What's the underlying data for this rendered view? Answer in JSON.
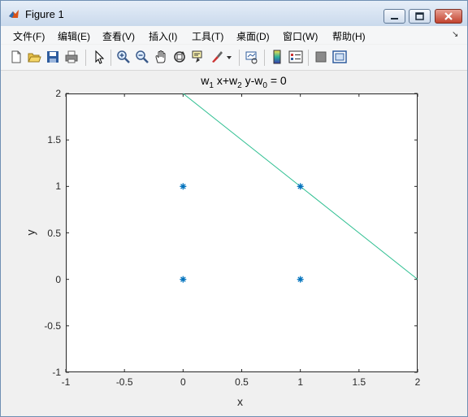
{
  "window": {
    "title": "Figure 1"
  },
  "menu": {
    "items": [
      {
        "label": "文件(F)",
        "key": "file"
      },
      {
        "label": "编辑(E)",
        "key": "edit"
      },
      {
        "label": "查看(V)",
        "key": "view"
      },
      {
        "label": "插入(I)",
        "key": "insert"
      },
      {
        "label": "工具(T)",
        "key": "tools"
      },
      {
        "label": "桌面(D)",
        "key": "desktop"
      },
      {
        "label": "窗口(W)",
        "key": "window"
      },
      {
        "label": "帮助(H)",
        "key": "help"
      }
    ]
  },
  "toolbar": {
    "icons": [
      "new-figure-icon",
      "open-icon",
      "save-icon",
      "print-icon",
      "select-arrow-icon",
      "zoom-in-icon",
      "zoom-out-icon",
      "pan-hand-icon",
      "rotate-3d-icon",
      "data-cursor-icon",
      "brush-icon",
      "brush-dropdown-icon",
      "link-plot-icon",
      "colorbar-icon",
      "legend-icon",
      "hide-plot-tools-icon",
      "show-plot-tools-icon"
    ]
  },
  "chart_data": {
    "type": "scatter",
    "title": "w_1 x+w_2 y-w_0 = 0",
    "title_parts": {
      "w": "w",
      "sub1": "1",
      "mid1": " x+w",
      "sub2": "2",
      "mid2": " y-w",
      "sub3": "0",
      "tail": " = 0"
    },
    "xlabel": "x",
    "ylabel": "y",
    "xlim": [
      -1,
      2
    ],
    "ylim": [
      -1,
      2
    ],
    "xticks": [
      "-1",
      "-0.5",
      "0",
      "0.5",
      "1",
      "1.5",
      "2"
    ],
    "xtick_values": [
      -1,
      -0.5,
      0,
      0.5,
      1,
      1.5,
      2
    ],
    "yticks": [
      "-1",
      "-0.5",
      "0",
      "0.5",
      "1",
      "1.5",
      "2"
    ],
    "ytick_values": [
      -1,
      -0.5,
      0,
      0.5,
      1,
      1.5,
      2
    ],
    "grid": false,
    "points": {
      "marker": "asterisk",
      "color": "#0072BD",
      "x": [
        0,
        0,
        1,
        1
      ],
      "y": [
        0,
        1,
        0,
        1
      ]
    },
    "line": {
      "color": "#2EBF91",
      "x": [
        0,
        2
      ],
      "y": [
        2,
        0
      ]
    }
  }
}
